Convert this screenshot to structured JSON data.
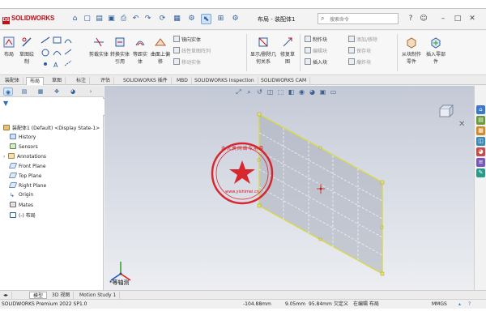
{
  "app": {
    "logo_text": "SOLIDWORKS",
    "document_title": "布局 - 装配体1",
    "search_placeholder": "搜索命令"
  },
  "ribbon": {
    "big_buttons": [
      {
        "label": "布局",
        "icon": "layout-icon"
      },
      {
        "label": "草图绘制",
        "icon": "sketch-icon"
      },
      {
        "label": "剪裁实体",
        "icon": "trim-icon"
      },
      {
        "label": "转换实体引用",
        "icon": "convert-icon"
      },
      {
        "label": "等距实体",
        "icon": "offset-icon"
      },
      {
        "label": "曲面上偏移",
        "icon": "surface-offset-icon"
      },
      {
        "label": "显示/删除几何关系",
        "icon": "relations-icon"
      },
      {
        "label": "修复草图",
        "icon": "repair-sketch-icon"
      },
      {
        "label": "从块制作零件",
        "icon": "make-part-icon"
      },
      {
        "label": "插入零部件",
        "icon": "insert-component-icon"
      }
    ],
    "small_items": {
      "mirror": "镜向实体",
      "linear_pattern": "线性草图阵列",
      "move": "移动实体",
      "make_block": "制作块",
      "edit_block": "编辑块",
      "insert_block": "插入块",
      "add_remove": "添加/移除",
      "save_block": "保存块",
      "explode": "爆炸块"
    }
  },
  "tabs": [
    "装配体",
    "布局",
    "草图",
    "标注",
    "评估",
    "SOLIDWORKS 插件",
    "MBD",
    "SOLIDWORKS Inspection",
    "SOLIDWORKS CAM"
  ],
  "active_tab_index": 1,
  "tree": {
    "root": "装配体1 (Default) <Display State-1>",
    "items": [
      "History",
      "Sensors",
      "Annotations",
      "Front Plane",
      "Top Plane",
      "Right Plane",
      "Origin",
      "Mates",
      "(-) 布局"
    ]
  },
  "viewport": {
    "view_label": "*等轴测"
  },
  "watermark": {
    "text_top": "永 大 美 网 络 专 用 章",
    "text_bottom": "www.yishimei.cn"
  },
  "bottom_tabs": [
    "模型",
    "3D 视图",
    "Motion Study 1"
  ],
  "status": {
    "app_version": "SOLIDWORKS Premium 2022 SP1.0",
    "x": "-104.88mm",
    "y": "9.05mm",
    "z": "95.84mm",
    "definition": "欠定义",
    "mode": "在编辑 布局",
    "units": "MMGS"
  },
  "colors": {
    "accent": "#c0101a",
    "viewport_top": "#c4c9d6",
    "plane_edge": "#d8d84a"
  }
}
